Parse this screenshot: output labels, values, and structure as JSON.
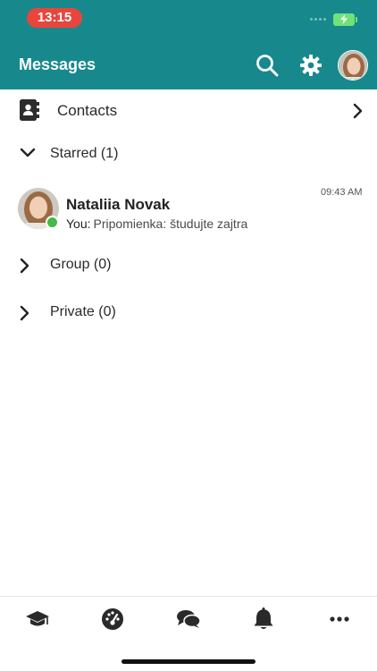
{
  "status_bar": {
    "time": "13:15"
  },
  "header": {
    "title": "Messages"
  },
  "contacts": {
    "label": "Contacts"
  },
  "sections": {
    "starred": "Starred (1)",
    "group": "Group (0)",
    "private": "Private (0)"
  },
  "conversation": {
    "name": "Nataliia Novak",
    "sender_prefix": "You:",
    "preview": "Pripomienka: študujte zajtra",
    "time": "09:43 AM",
    "online": true
  },
  "bottom_nav": {
    "items": [
      "courses-icon",
      "dashboard-icon",
      "messages-icon",
      "notifications-icon",
      "more-icon"
    ]
  },
  "colors": {
    "header_bg": "#17898d",
    "time_pill": "#e8453c",
    "online": "#43b94c"
  }
}
